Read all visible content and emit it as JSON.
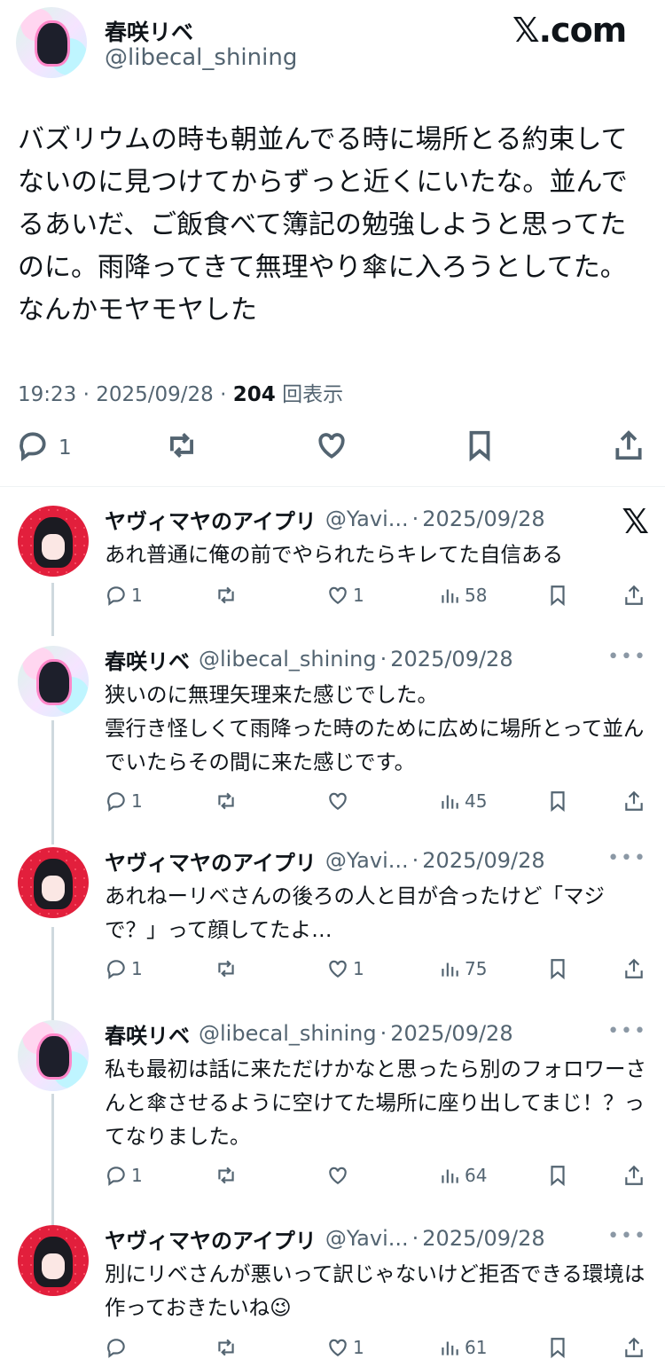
{
  "main": {
    "name": "春咲リベ",
    "handle": "@libecal_shining",
    "site_logo": "𝕏.com",
    "text": "バズリウムの時も朝並んでる時に場所とる約束してないのに見つけてからずっと近くにいたな。並んでるあいだ、ご飯食べて簿記の勉強しようと思ってたのに。雨降ってきて無理やり傘に入ろうとしてた。なんかモヤモヤした",
    "time": "19:23",
    "date": "2025/09/28",
    "views": "204",
    "views_label": "回表示",
    "reply_count": "1"
  },
  "replies": [
    {
      "name": "ヤヴィマヤのアイプリ",
      "handle": "@Yavi...",
      "date": "2025/09/28",
      "text": "あれ普通に俺の前でやられたらキレてた自信ある",
      "replies": "1",
      "likes": "1",
      "views": "58",
      "top_right": "𝕏"
    },
    {
      "name": "春咲リベ",
      "handle": "@libecal_shining",
      "date": "2025/09/28",
      "text": "狭いのに無理矢理来た感じでした。\n雲行き怪しくて雨降った時のために広めに場所とって並んでいたらその間に来た感じです。",
      "replies": "1",
      "likes": "",
      "views": "45",
      "top_right": "•••"
    },
    {
      "name": "ヤヴィマヤのアイプリ",
      "handle": "@Yavi...",
      "date": "2025/09/28",
      "text": "あれねーリベさんの後ろの人と目が合ったけど「マジで？」って顔してたよ…",
      "replies": "1",
      "likes": "1",
      "views": "75",
      "top_right": "•••"
    },
    {
      "name": "春咲リベ",
      "handle": "@libecal_shining",
      "date": "2025/09/28",
      "text": "私も最初は話に来ただけかなと思ったら別のフォロワーさんと傘させるように空けてた場所に座り出してまじ！？ってなりました。",
      "replies": "1",
      "likes": "",
      "views": "64",
      "top_right": "•••"
    },
    {
      "name": "ヤヴィマヤのアイプリ",
      "handle": "@Yavi...",
      "date": "2025/09/28",
      "text": "別にリベさんが悪いって訳じゃないけど拒否できる環境は作っておきたいね😉",
      "replies": "",
      "likes": "1",
      "views": "61",
      "top_right": "•••"
    }
  ],
  "separator": "·"
}
